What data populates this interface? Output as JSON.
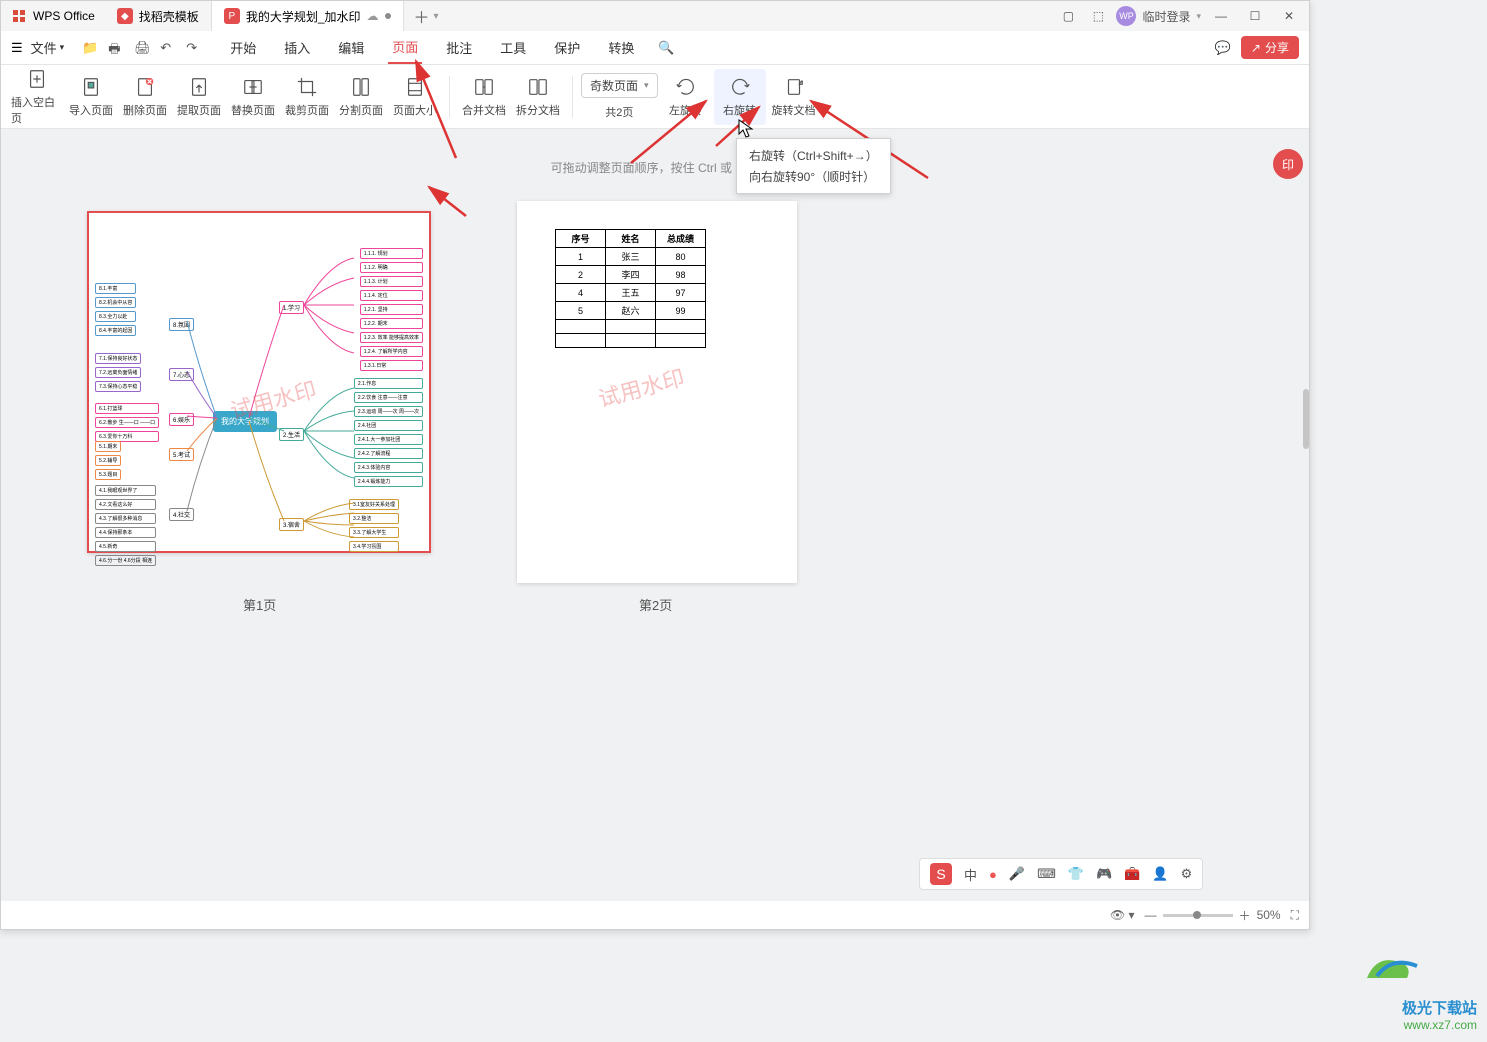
{
  "app": {
    "name": "WPS Office"
  },
  "tabs": [
    {
      "label": "找稻壳模板"
    },
    {
      "label": "我的大学规划_加水印"
    }
  ],
  "login": "临时登录",
  "menubar": {
    "file": "文件",
    "items": [
      "开始",
      "插入",
      "编辑",
      "页面",
      "批注",
      "工具",
      "保护",
      "转换"
    ],
    "active": "页面",
    "share": "分享"
  },
  "ribbon": {
    "insert_blank": "插入空白页",
    "import_page": "导入页面",
    "delete_page": "删除页面",
    "extract_page": "提取页面",
    "replace_page": "替换页面",
    "crop_page": "裁剪页面",
    "split_page": "分割页面",
    "page_size": "页面大小",
    "merge_doc": "合并文档",
    "split_doc": "拆分文档",
    "page_select": "奇数页面",
    "total_pages": "共2页",
    "rotate_left": "左旋转",
    "rotate_right": "右旋转",
    "rotate_doc": "旋转文档"
  },
  "tooltip": {
    "title": "右旋转（Ctrl+Shift+→）",
    "desc": "向右旋转90°（顺时针）"
  },
  "hint": "可拖动调整页面顺序，按住 Ctrl 或 Shift",
  "pages": {
    "p1": "第1页",
    "p2": "第2页"
  },
  "mindmap": {
    "center": "我的大学规划",
    "branches": [
      "1.学习",
      "2.生活",
      "3.宿舍",
      "4.社交",
      "5.考试",
      "6.娱乐",
      "7.心态",
      "8.氛围"
    ]
  },
  "watermark": "试用水印",
  "table": {
    "headers": [
      "序号",
      "姓名",
      "总成绩"
    ],
    "rows": [
      [
        "1",
        "张三",
        "80"
      ],
      [
        "2",
        "李四",
        "98"
      ],
      [
        "4",
        "王五",
        "97"
      ],
      [
        "5",
        "赵六",
        "99"
      ],
      [
        "",
        "",
        ""
      ],
      [
        "",
        "",
        ""
      ]
    ]
  },
  "status": {
    "zoom": "50%"
  },
  "floatbtn": "印",
  "ime": "中",
  "site": {
    "name": "极光下载站",
    "url": "www.xz7.com"
  }
}
